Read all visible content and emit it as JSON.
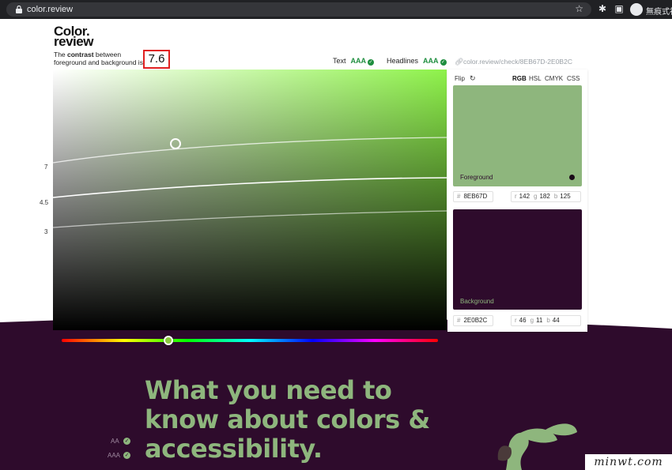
{
  "browser": {
    "url": "color.review",
    "profile_label": "無痕式視"
  },
  "header": {
    "logo_line1": "Color.",
    "logo_line2": "review",
    "subtitle_pre": "The ",
    "subtitle_bold": "contrast",
    "subtitle_post": " between foreground and background is",
    "contrast_value": "7.6",
    "text_label": "Text",
    "text_rating": "AAA",
    "headlines_label": "Headlines",
    "headlines_rating": "AAA",
    "check_url": "color.review/check/8EB67D-2E0B2C"
  },
  "picker": {
    "axis_labels": [
      "7",
      "4.5",
      "3"
    ]
  },
  "panel": {
    "flip_label": "Flip",
    "tabs": [
      "RGB",
      "HSL",
      "CMYK",
      "CSS"
    ],
    "active_tab": "RGB",
    "foreground": {
      "label": "Foreground",
      "hex": "8EB67D",
      "r": "142",
      "g": "182",
      "b": "125",
      "color": "#8eb67d"
    },
    "background": {
      "label": "Background",
      "hex": "2E0B2C",
      "r": "46",
      "g": "11",
      "b": "44",
      "color": "#2e0b2c"
    }
  },
  "hero": {
    "line1": "What you need to",
    "line2": "know about colors &",
    "line3": "accessibility.",
    "aa_label": "AA",
    "aaa_label": "AAA"
  },
  "watermark": "minwt.com",
  "colors": {
    "accent_green": "#1e8e3e",
    "purple": "#2e0b2c",
    "sage": "#8eb67d"
  }
}
